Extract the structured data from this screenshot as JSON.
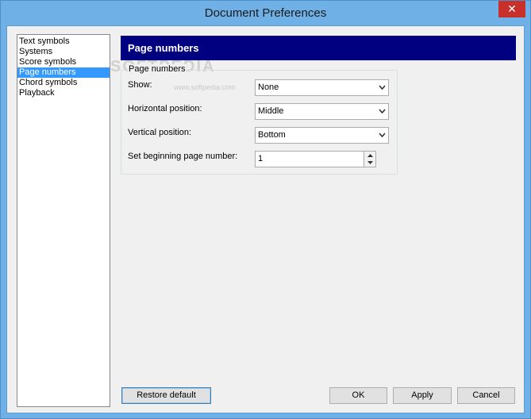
{
  "window": {
    "title": "Document Preferences",
    "close_glyph": "✕"
  },
  "categories": [
    {
      "label": "Text symbols"
    },
    {
      "label": "Systems"
    },
    {
      "label": "Score symbols"
    },
    {
      "label": "Page numbers",
      "selected": true
    },
    {
      "label": "Chord symbols"
    },
    {
      "label": "Playback"
    }
  ],
  "panel": {
    "banner_title": "Page numbers",
    "group_label": "Page numbers",
    "show": {
      "label": "Show:",
      "value": "None"
    },
    "horizontal": {
      "label": "Horizontal position:",
      "value": "Middle"
    },
    "vertical": {
      "label": "Vertical position:",
      "value": "Bottom"
    },
    "begin": {
      "label": "Set beginning page number:",
      "value": "1"
    }
  },
  "watermark": {
    "text": "SOFTPEDIA",
    "url": "www.softpedia.com"
  },
  "buttons": {
    "restore": "Restore default",
    "ok": "OK",
    "apply": "Apply",
    "cancel": "Cancel"
  },
  "colors": {
    "banner_bg": "#000080",
    "selection": "#3399ff",
    "titlebar": "#6fb0e6",
    "close": "#c7302b"
  }
}
